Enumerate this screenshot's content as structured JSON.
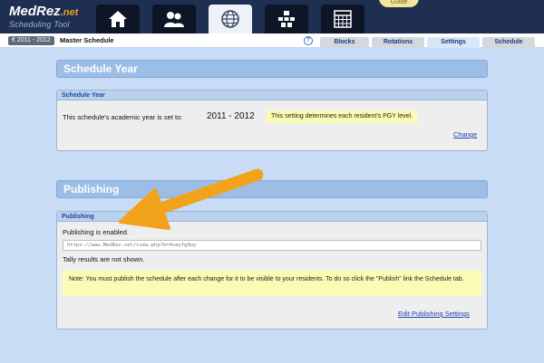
{
  "app": {
    "logo_main": "MedRez",
    "logo_suffix": ".net",
    "logo_sub": "Scheduling Tool",
    "guide_label": "Guide"
  },
  "nav": [
    {
      "icon": "home-icon",
      "active": false
    },
    {
      "icon": "people-icon",
      "active": false
    },
    {
      "icon": "globe-icon",
      "active": true
    },
    {
      "icon": "organization-icon",
      "active": false
    },
    {
      "icon": "calendar-grid-icon",
      "active": false
    }
  ],
  "subheader": {
    "year_badge": "€ 2011 - 2012",
    "title": "Master Schedule",
    "help": "?",
    "tabs": [
      {
        "label": "Blocks",
        "active": false
      },
      {
        "label": "Rotations",
        "active": false
      },
      {
        "label": "Settings",
        "active": true
      },
      {
        "label": "Schedule",
        "active": false
      }
    ]
  },
  "schedule_year": {
    "section_title": "Schedule Year",
    "panel_title": "Schedule Year",
    "description": "This schedule's academic year is set to:",
    "year_value": "2011 - 2012",
    "note": "This setting determines each resident's PGY level.",
    "change_link": "Change"
  },
  "publishing": {
    "section_title": "Publishing",
    "panel_title": "Publishing",
    "status": "Publishing is enabled.",
    "url": "https://www.MedRez.net/view.php?b=4xeyfg9uy",
    "tally": "Tally results are not shown.",
    "note": "Note: You must publish the schedule after each change for it to be visible to your residents. To do so click the \"Publish\" link the Schedule tab.",
    "edit_link": "Edit Publishing Settings"
  },
  "colors": {
    "header_bg": "#1e2f52",
    "page_bg": "#c9dcf5",
    "section_head": "#9bbde6",
    "note_yellow": "#fbfbb4",
    "arrow": "#f2a31b"
  }
}
